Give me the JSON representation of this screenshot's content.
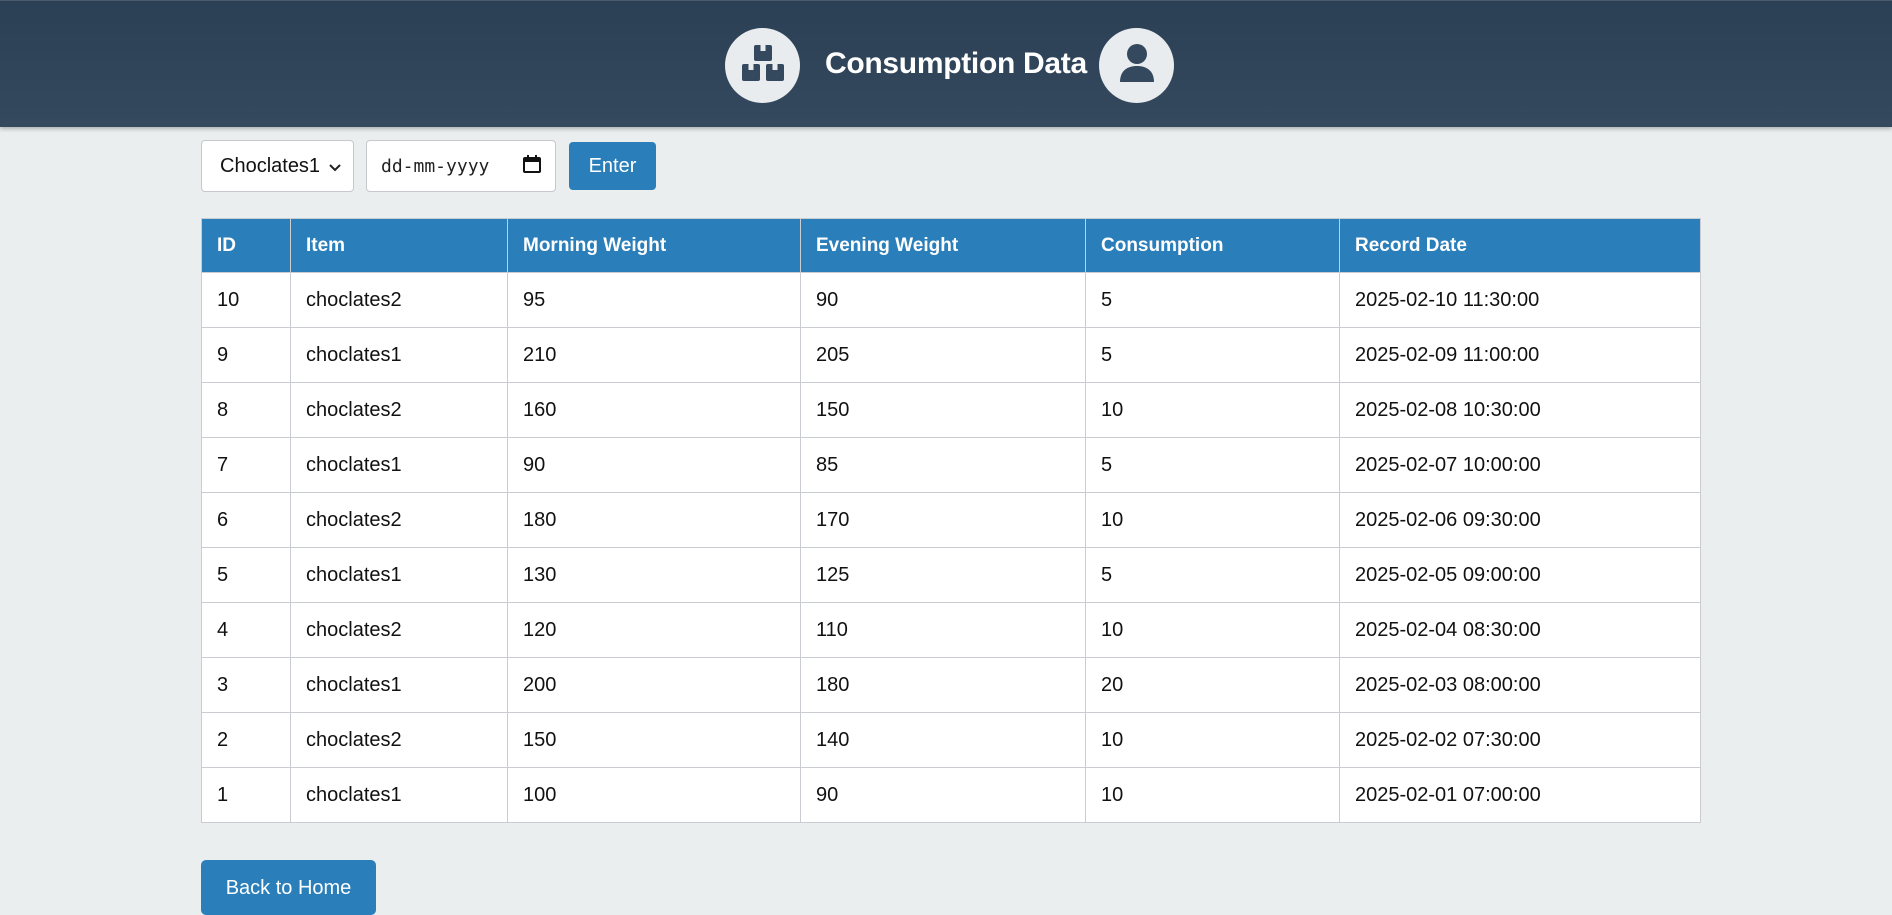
{
  "header": {
    "title": "Consumption Data",
    "left_icon": "boxes-icon",
    "right_icon": "user-icon"
  },
  "filters": {
    "item_select_value": "Choclates1",
    "date_placeholder": "dd-mm-yyyy",
    "enter_label": "Enter"
  },
  "table": {
    "columns": [
      "ID",
      "Item",
      "Morning Weight",
      "Evening Weight",
      "Consumption",
      "Record Date"
    ],
    "rows": [
      [
        "10",
        "choclates2",
        "95",
        "90",
        "5",
        "2025-02-10 11:30:00"
      ],
      [
        "9",
        "choclates1",
        "210",
        "205",
        "5",
        "2025-02-09 11:00:00"
      ],
      [
        "8",
        "choclates2",
        "160",
        "150",
        "10",
        "2025-02-08 10:30:00"
      ],
      [
        "7",
        "choclates1",
        "90",
        "85",
        "5",
        "2025-02-07 10:00:00"
      ],
      [
        "6",
        "choclates2",
        "180",
        "170",
        "10",
        "2025-02-06 09:30:00"
      ],
      [
        "5",
        "choclates1",
        "130",
        "125",
        "5",
        "2025-02-05 09:00:00"
      ],
      [
        "4",
        "choclates2",
        "120",
        "110",
        "10",
        "2025-02-04 08:30:00"
      ],
      [
        "3",
        "choclates1",
        "200",
        "180",
        "20",
        "2025-02-03 08:00:00"
      ],
      [
        "2",
        "choclates2",
        "150",
        "140",
        "10",
        "2025-02-02 07:30:00"
      ],
      [
        "1",
        "choclates1",
        "100",
        "90",
        "10",
        "2025-02-01 07:00:00"
      ]
    ]
  },
  "footer": {
    "back_label": "Back to Home"
  },
  "colors": {
    "header_bg": "#2f4359",
    "accent": "#2a7fba",
    "page_bg": "#eaeeef"
  }
}
